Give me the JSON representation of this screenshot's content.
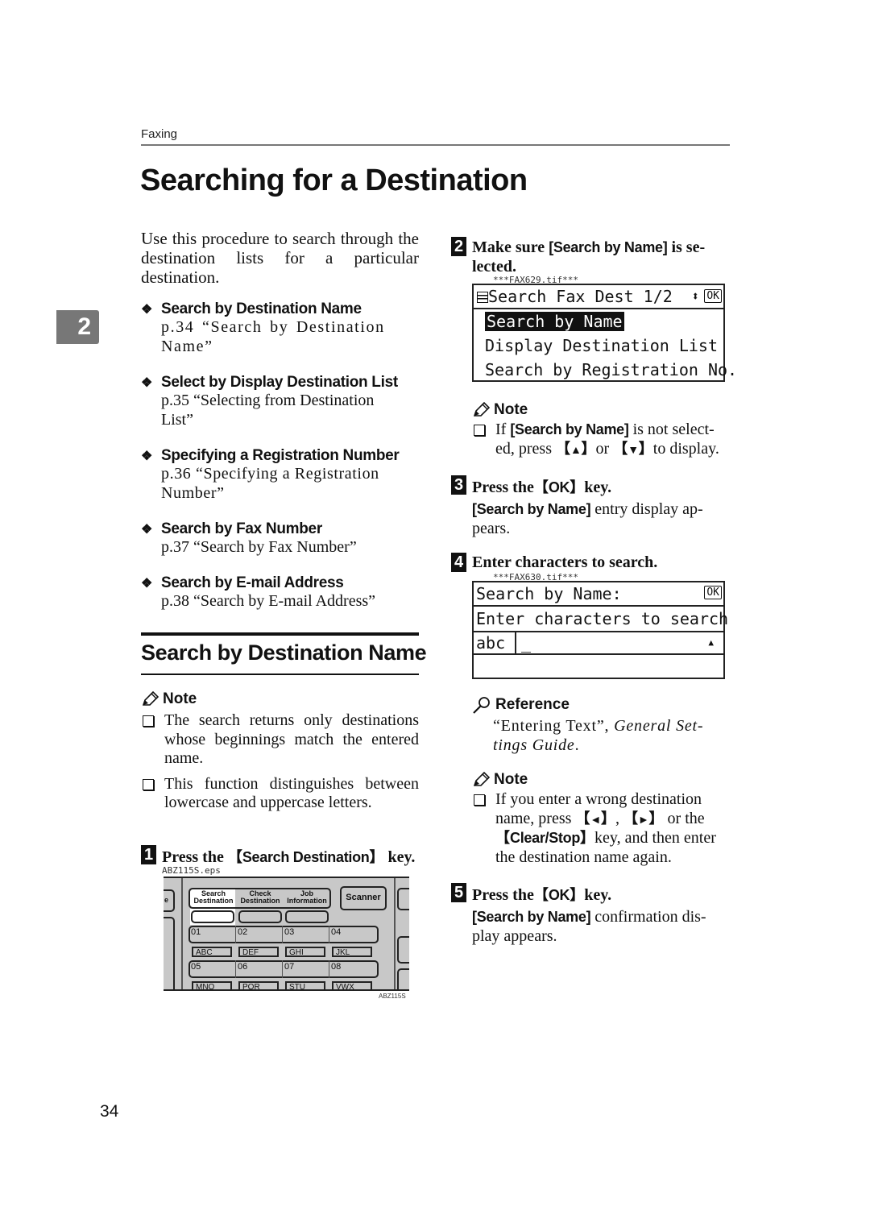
{
  "header": {
    "section_label": "Faxing"
  },
  "page_title": "Searching for a Destination",
  "chapter_tab": "2",
  "intro": "Use this procedure to search through the destination lists for a particular destination.",
  "methods": [
    {
      "heading": "Search by Destination Name",
      "ref_line1": "p.34 “Search by Destination",
      "ref_line2": "Name”"
    },
    {
      "heading": "Select by Display Destination List",
      "ref_line1": "p.35 “Selecting from Destination",
      "ref_line2": "List”"
    },
    {
      "heading": "Specifying a Registration Number",
      "ref_line1": "p.36 “Specifying a Registration",
      "ref_line2": "Number”"
    },
    {
      "heading": "Search by Fax Number",
      "ref_line1": "p.37 “Search by Fax Number”"
    },
    {
      "heading": "Search by E-mail Address",
      "ref_line1": "p.38 “Search by E-mail Address”"
    }
  ],
  "section": {
    "title": "Search by Destination Name",
    "note_label": "Note",
    "notes": [
      "The search returns only destinations whose beginnings match the entered name.",
      "This function distinguishes between lowercase and uppercase letters."
    ]
  },
  "steps": {
    "s1": {
      "num": "1",
      "pre": "Press the",
      "key": "Search Destination",
      "post": "key.",
      "file": "ABZ115S.eps",
      "caption": "ABZ115S"
    },
    "s2": {
      "num": "2",
      "pre": "Make sure",
      "key": "[Search by Name]",
      "post": "is se-",
      "line2": "lected.",
      "file": "***FAX629.tif***"
    },
    "s3": {
      "num": "3",
      "pre": "Press the",
      "key": "OK",
      "post": "key.",
      "desc_key": "[Search by Name]",
      "desc": "entry display ap-",
      "desc2": "pears."
    },
    "s4": {
      "num": "4",
      "text": "Enter characters to search.",
      "file": "***FAX630.tif***"
    },
    "s5": {
      "num": "5",
      "pre": "Press the",
      "key": "OK",
      "post": "key.",
      "desc_key": "[Search by Name]",
      "desc": "confirmation dis-",
      "desc2": "play appears."
    }
  },
  "note2": {
    "label": "Note",
    "pre": "If",
    "key": "[Search by Name]",
    "post": "is not select-",
    "line2_pre": "ed, press",
    "up": "▲",
    "or": "or",
    "down": "▼",
    "line2_post": "to display."
  },
  "reference": {
    "label": "Reference",
    "quote": "“Entering Text”,",
    "italic1": "General Set-",
    "italic2": "tings Guide",
    "end": "."
  },
  "note3": {
    "label": "Note",
    "line1": "If you enter a wrong destination",
    "line2_pre": "name, press",
    "left": "◄",
    "right": "►",
    "line2_post": "or the",
    "key": "Clear/Stop",
    "line3_post": "key, and then enter",
    "line4": "the destination name again."
  },
  "lcd1": {
    "title": "Search Fax Dest",
    "page": "1/2",
    "ok": "OK",
    "items": [
      "Search by Name",
      "Display Destination List",
      "Search by Registration No."
    ],
    "selected_index": 0
  },
  "lcd2": {
    "title": "Search by Name:",
    "ok": "OK",
    "prompt": "Enter characters to search",
    "mode": "abc",
    "cursor": "_"
  },
  "panel": {
    "tabs": [
      {
        "line1": "Search",
        "line2": "Destination"
      },
      {
        "line1": "Check",
        "line2": "Destination"
      },
      {
        "line1": "Job",
        "line2": "Information"
      }
    ],
    "scanner": "Scanner",
    "edge_label": "e",
    "numbers_row1": [
      "01",
      "02",
      "03",
      "04"
    ],
    "keys_row1": [
      "ABC",
      "DEF",
      "GHI",
      "JKL"
    ],
    "numbers_row2": [
      "05",
      "06",
      "07",
      "08"
    ],
    "keys_row2": [
      "MNO",
      "PQR",
      "STU",
      "VWX"
    ]
  },
  "page_number": "34"
}
